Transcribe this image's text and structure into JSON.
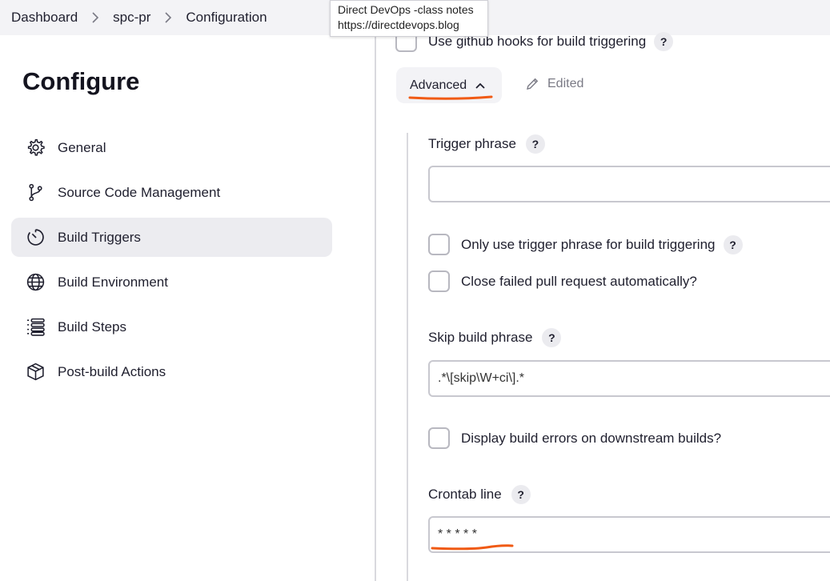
{
  "breadcrumb": {
    "items": [
      "Dashboard",
      "spc-pr",
      "Configuration"
    ]
  },
  "tooltip": {
    "title": "Direct DevOps -class notes",
    "url": "https://directdevops.blog"
  },
  "sidebar": {
    "title": "Configure",
    "items": [
      {
        "label": "General",
        "icon": "gear-icon"
      },
      {
        "label": "Source Code Management",
        "icon": "git-branch-icon"
      },
      {
        "label": "Build Triggers",
        "icon": "timer-icon",
        "active": true
      },
      {
        "label": "Build Environment",
        "icon": "globe-icon"
      },
      {
        "label": "Build Steps",
        "icon": "list-icon"
      },
      {
        "label": "Post-build Actions",
        "icon": "package-icon"
      }
    ]
  },
  "main": {
    "hooks_label": "Use github hooks for build triggering",
    "help_glyph": "?",
    "advanced_label": "Advanced",
    "edited_label": "Edited",
    "trigger_phrase": {
      "label": "Trigger phrase",
      "value": ""
    },
    "only_trigger_label": "Only use trigger phrase for build triggering",
    "close_failed_label": "Close failed pull request automatically?",
    "skip_build": {
      "label": "Skip build phrase",
      "value": ".*\\[skip\\W+ci\\].*"
    },
    "display_errors_label": "Display build errors on downstream builds?",
    "crontab": {
      "label": "Crontab line",
      "value": "* * * * *"
    }
  },
  "colors": {
    "annotation": "#f05a14",
    "active_nav_bg": "#ececf0"
  }
}
